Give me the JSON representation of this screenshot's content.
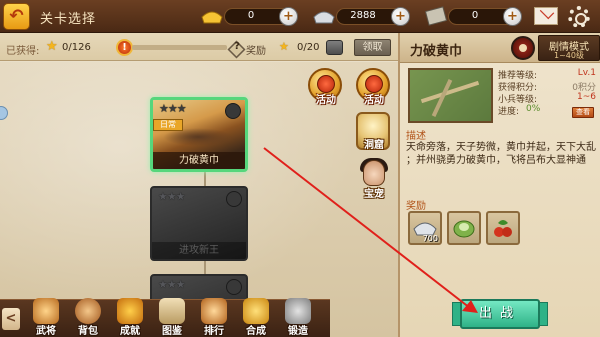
{
  "header": {
    "title": "关卡选择",
    "resources": [
      {
        "name": "gold",
        "value": "0"
      },
      {
        "name": "silver",
        "value": "2888"
      },
      {
        "name": "scroll",
        "value": "0"
      }
    ],
    "plus_label": "+"
  },
  "progress": {
    "collected_label": "已获得:",
    "collected_count": "0/126",
    "reward_label": "奖励",
    "reward_count": "0/20",
    "claim_label": "领取"
  },
  "map": {
    "stages": [
      {
        "name": "力破黄巾",
        "ribbon": "日常",
        "state": "active"
      },
      {
        "name": "进攻新王",
        "state": "locked"
      },
      {
        "name": "",
        "state": "locked"
      }
    ],
    "side_buttons": {
      "event1": "活动",
      "event2": "活动",
      "cave": "洞窟",
      "hero": "宝宠"
    }
  },
  "bottom_nav": {
    "arrow": "<",
    "items": [
      {
        "label": "武将",
        "icon": "general-icon"
      },
      {
        "label": "背包",
        "icon": "bag-icon"
      },
      {
        "label": "成就",
        "icon": "achievement-icon"
      },
      {
        "label": "图鉴",
        "icon": "codex-icon"
      },
      {
        "label": "排行",
        "icon": "ranking-icon"
      },
      {
        "label": "合成",
        "icon": "forge-icon"
      },
      {
        "label": "锻造",
        "icon": "anvil-icon"
      }
    ]
  },
  "panel": {
    "stage_title": "力破黄巾",
    "mode_name": "剧情模式",
    "mode_level": "1~40级",
    "stats": [
      {
        "key": "推荐等级:",
        "value": "Lv.1"
      },
      {
        "key": "获得积分:",
        "value": "0积分"
      },
      {
        "key": "小兵等级:",
        "value": "1~6"
      },
      {
        "key": "进度:",
        "value": "0%"
      }
    ],
    "view_label": "查看",
    "desc_label": "描述",
    "desc_lines": [
      "天命旁落，天子势微，黄巾并起，天下大乱",
      "；并州骁勇力破黄巾，飞将吕布大显神通"
    ],
    "rewards_label": "奖励",
    "rewards": [
      {
        "name": "silver-ingot",
        "count": "700"
      },
      {
        "name": "cabbage-item",
        "count": ""
      },
      {
        "name": "herb-item",
        "count": ""
      }
    ],
    "battle_label": "出战"
  },
  "colors": {
    "accent": "#f4b51e",
    "battle": "#2fb287",
    "annotation": "#e0201b"
  }
}
